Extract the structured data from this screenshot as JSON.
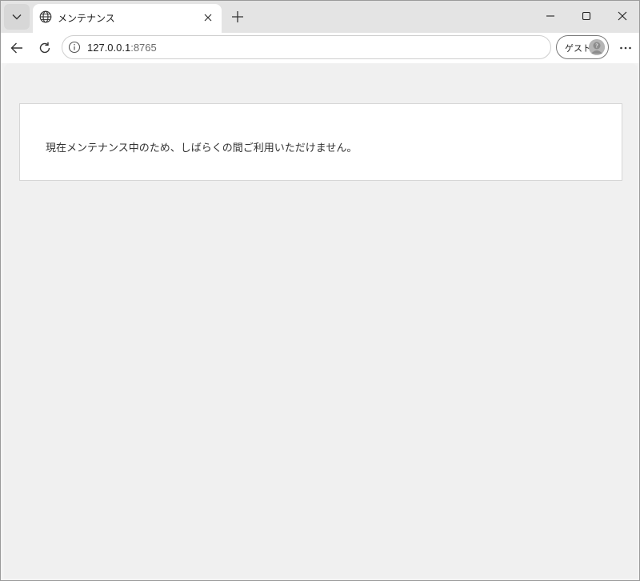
{
  "browser": {
    "tab": {
      "title": "メンテナンス",
      "favicon": "globe-icon"
    },
    "address": {
      "host": "127.0.0.1",
      "port": ":8765",
      "security_icon": "info-icon"
    },
    "profile": {
      "label": "ゲスト",
      "avatar_icon": "guest-avatar-icon"
    },
    "icons": {
      "tab_list": "chevron-down-icon",
      "tab_close": "close-icon",
      "new_tab": "plus-icon",
      "back": "back-arrow-icon",
      "reload": "reload-icon",
      "more": "more-icon",
      "minimize": "minimize-icon",
      "maximize": "maximize-icon",
      "window_close": "close-icon"
    }
  },
  "page": {
    "message": "現在メンテナンス中のため、しばらくの間ご利用いただけません。"
  },
  "colors": {
    "tabstrip": "#e4e4e4",
    "page_background": "#f0f0f0",
    "panel_background": "#ffffff",
    "panel_border": "#d6d6d6",
    "text": "#333333"
  }
}
